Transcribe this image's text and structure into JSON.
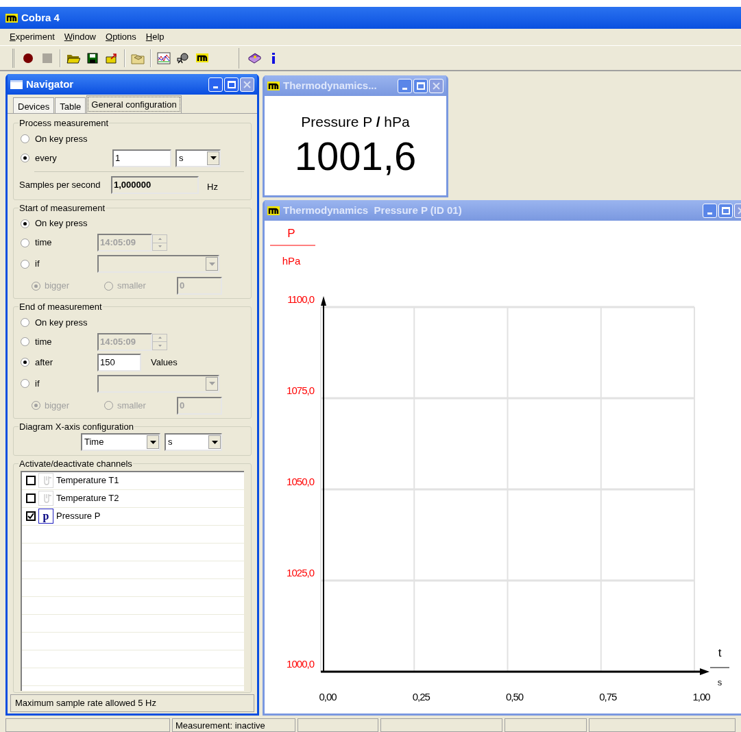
{
  "window": {
    "title": "Cobra 4"
  },
  "menu": [
    {
      "label": "Experiment"
    },
    {
      "label": "Window"
    },
    {
      "label": "Options"
    },
    {
      "label": "Help"
    }
  ],
  "toolbar": [
    {
      "kind": "record",
      "disabled": false
    },
    {
      "kind": "stop",
      "disabled": true
    },
    {
      "kind": "sep"
    },
    {
      "kind": "open"
    },
    {
      "kind": "save"
    },
    {
      "kind": "export"
    },
    {
      "kind": "sep"
    },
    {
      "kind": "library"
    },
    {
      "kind": "sep"
    },
    {
      "kind": "chart"
    },
    {
      "kind": "satellite"
    },
    {
      "kind": "logo"
    },
    {
      "kind": "gap"
    },
    {
      "kind": "help"
    },
    {
      "kind": "info"
    }
  ],
  "navigator": {
    "title": "Navigator",
    "active": true,
    "tabs": [
      {
        "label": "Devices",
        "selected": false
      },
      {
        "label": "Table",
        "selected": false
      },
      {
        "label": "General configuration",
        "selected": true
      }
    ],
    "process": {
      "title": "Process measurement",
      "options": [
        {
          "kind": "plain",
          "label": "On key press",
          "selected": false
        },
        {
          "kind": "interval",
          "label": "every",
          "selected": true,
          "value": "1",
          "unit": "s"
        }
      ],
      "rate_label": "Samples per second",
      "rate_value": "1,000000",
      "rate_unit": "Hz"
    },
    "start": {
      "title": "Start of measurement",
      "options": [
        {
          "kind": "plain",
          "label": "On key press",
          "selected": true
        },
        {
          "kind": "time",
          "label": "time",
          "selected": false,
          "value": "14:05:09",
          "field_disabled": true
        },
        {
          "kind": "condition",
          "label": "if",
          "selected": false,
          "field_disabled": true,
          "comparisons": [
            {
              "label": "bigger",
              "selected": true
            },
            {
              "label": "smaller",
              "selected": false
            }
          ],
          "threshold": "0"
        }
      ]
    },
    "end": {
      "title": "End of measurement",
      "options": [
        {
          "kind": "plain",
          "label": "On key press",
          "selected": false
        },
        {
          "kind": "time",
          "label": "time",
          "selected": false,
          "value": "14:05:09",
          "field_disabled": true
        },
        {
          "kind": "count",
          "label": "after",
          "selected": true,
          "value": "150",
          "unit": "Values"
        },
        {
          "kind": "condition",
          "label": "if",
          "selected": false,
          "field_disabled": true,
          "comparisons": [
            {
              "label": "bigger",
              "selected": true
            },
            {
              "label": "smaller",
              "selected": false
            }
          ],
          "threshold": "0"
        }
      ]
    },
    "x_axis": {
      "title": "Diagram X-axis configuration",
      "quantity": "Time",
      "unit": "s"
    },
    "channels": {
      "title": "Activate/deactivate channels",
      "items": [
        {
          "label": "Temperature T1",
          "checked": false,
          "kind": "temperature"
        },
        {
          "label": "Temperature T2",
          "checked": false,
          "kind": "temperature"
        },
        {
          "label": "Pressure P",
          "checked": true,
          "kind": "pressure",
          "symbol": "p"
        }
      ]
    },
    "hint": "Maximum sample rate allowed 5 Hz"
  },
  "display": {
    "title": "Thermodynamics...",
    "active": false,
    "quantity": "Pressure P **/** hPa",
    "value": "1001,6"
  },
  "chart": {
    "title": "Thermodynamics  Pressure P (ID 01)",
    "active": false,
    "y_quantity": "P",
    "y_unit": "hPa",
    "x_quantity": "t",
    "x_unit": "s",
    "chart_data": {
      "type": "line",
      "grid": true,
      "xlim": [
        0,
        1
      ],
      "ylim": [
        1000,
        1100
      ],
      "xticks": [
        {
          "value": 0,
          "label": "0,00"
        },
        {
          "value": 0.25,
          "label": "0,25"
        },
        {
          "value": 0.5,
          "label": "0,50"
        },
        {
          "value": 0.75,
          "label": "0,75"
        },
        {
          "value": 1,
          "label": "1,00"
        }
      ],
      "yticks": [
        {
          "value": 1000,
          "label": "1000,0"
        },
        {
          "value": 1025,
          "label": "1025,0"
        },
        {
          "value": 1050,
          "label": "1050,0"
        },
        {
          "value": 1075,
          "label": "1075,0"
        },
        {
          "value": 1100,
          "label": "1100,0"
        }
      ]
    }
  },
  "status_bar": {
    "text": "Measurement: inactive"
  }
}
